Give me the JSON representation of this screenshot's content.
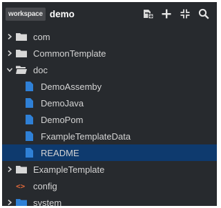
{
  "header": {
    "workspace_badge": "workspace",
    "workspace_name": "demo",
    "actions": [
      {
        "icon": "new-file-icon"
      },
      {
        "icon": "add-icon"
      },
      {
        "icon": "collapse-all-icon"
      },
      {
        "icon": "search-icon"
      }
    ]
  },
  "tree": {
    "items": [
      {
        "label": "com",
        "type": "folder",
        "expanded": false
      },
      {
        "label": "CommonTemplate",
        "type": "folder",
        "expanded": false
      },
      {
        "label": "doc",
        "type": "folder",
        "expanded": true
      },
      {
        "label": "DemoAssemby",
        "type": "file"
      },
      {
        "label": "DemoJava",
        "type": "file"
      },
      {
        "label": "DemoPom",
        "type": "file"
      },
      {
        "label": "FxampleTemplateData",
        "type": "file"
      },
      {
        "label": "README",
        "type": "file",
        "selected": true
      },
      {
        "label": "ExampleTemplate",
        "type": "folder",
        "expanded": false
      },
      {
        "label": "config",
        "type": "code-file"
      },
      {
        "label": "system",
        "type": "folder",
        "expanded": false
      }
    ]
  },
  "colors": {
    "background": "#272a2e",
    "selected_row": "#0e3a6e",
    "file_icon": "#2f80d6",
    "folder_icon": "#d8d8d8",
    "code_icon": "#e0683a"
  }
}
